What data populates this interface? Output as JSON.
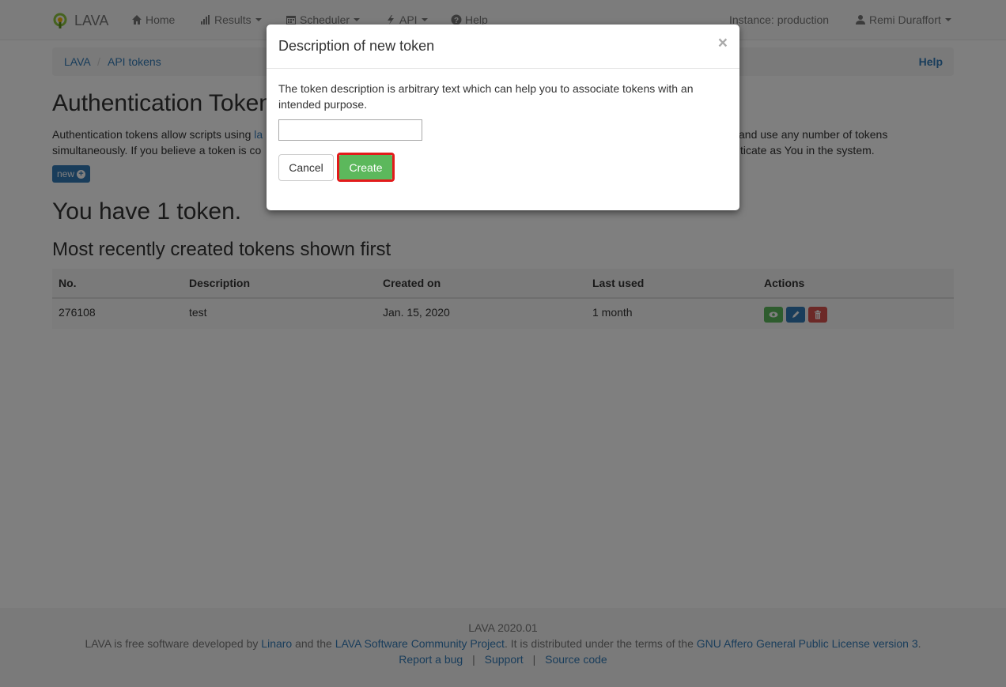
{
  "navbar": {
    "brand": "LAVA",
    "items": [
      {
        "label": "Home",
        "icon": "home-icon"
      },
      {
        "label": "Results",
        "icon": "bar-chart-icon"
      },
      {
        "label": "Scheduler",
        "icon": "calendar-icon"
      },
      {
        "label": "API",
        "icon": "bolt-icon"
      },
      {
        "label": "Help",
        "icon": "question-circle-icon"
      }
    ],
    "instance": "Instance: production",
    "user": "Remi Duraffort"
  },
  "breadcrumb": {
    "items": [
      "LAVA",
      "API tokens"
    ],
    "help": "Help"
  },
  "page": {
    "title": "Authentication Tokens",
    "intro_line1_start": "Authentication tokens allow scripts using ",
    "intro_link": "la",
    "intro_line1_end": "and use any number of tokens",
    "intro_line2_start": "simultaneously. If you believe a token is co",
    "intro_line2_end": "ticate as You in the system.",
    "new_button": "new",
    "token_count": "You have 1 token.",
    "subtitle": "Most recently created tokens shown first"
  },
  "table": {
    "columns": [
      "No.",
      "Description",
      "Created on",
      "Last used",
      "Actions"
    ],
    "rows": [
      {
        "no": "276108",
        "description": "test",
        "created_on": "Jan. 15, 2020",
        "last_used": "1 month"
      }
    ]
  },
  "footer": {
    "version": "LAVA 2020.01",
    "line2_a": "LAVA is free software developed by ",
    "linaro": "Linaro",
    "line2_b": " and the ",
    "community": "LAVA Software Community Project",
    "line2_c": ". It is distributed under the terms of the ",
    "license": "GNU Affero General Public License version 3",
    "line2_d": ".",
    "report_bug": "Report a bug",
    "support": "Support",
    "source_code": "Source code",
    "separator": "|"
  },
  "modal": {
    "title": "Description of new token",
    "close": "×",
    "body": "The token description is arbitrary text which can help you to associate tokens with an intended purpose.",
    "input_value": "",
    "cancel": "Cancel",
    "create": "Create"
  },
  "colors": {
    "primary": "#337ab7",
    "success": "#5cb85c",
    "danger": "#d9534f",
    "highlight": "#e21b1b"
  }
}
